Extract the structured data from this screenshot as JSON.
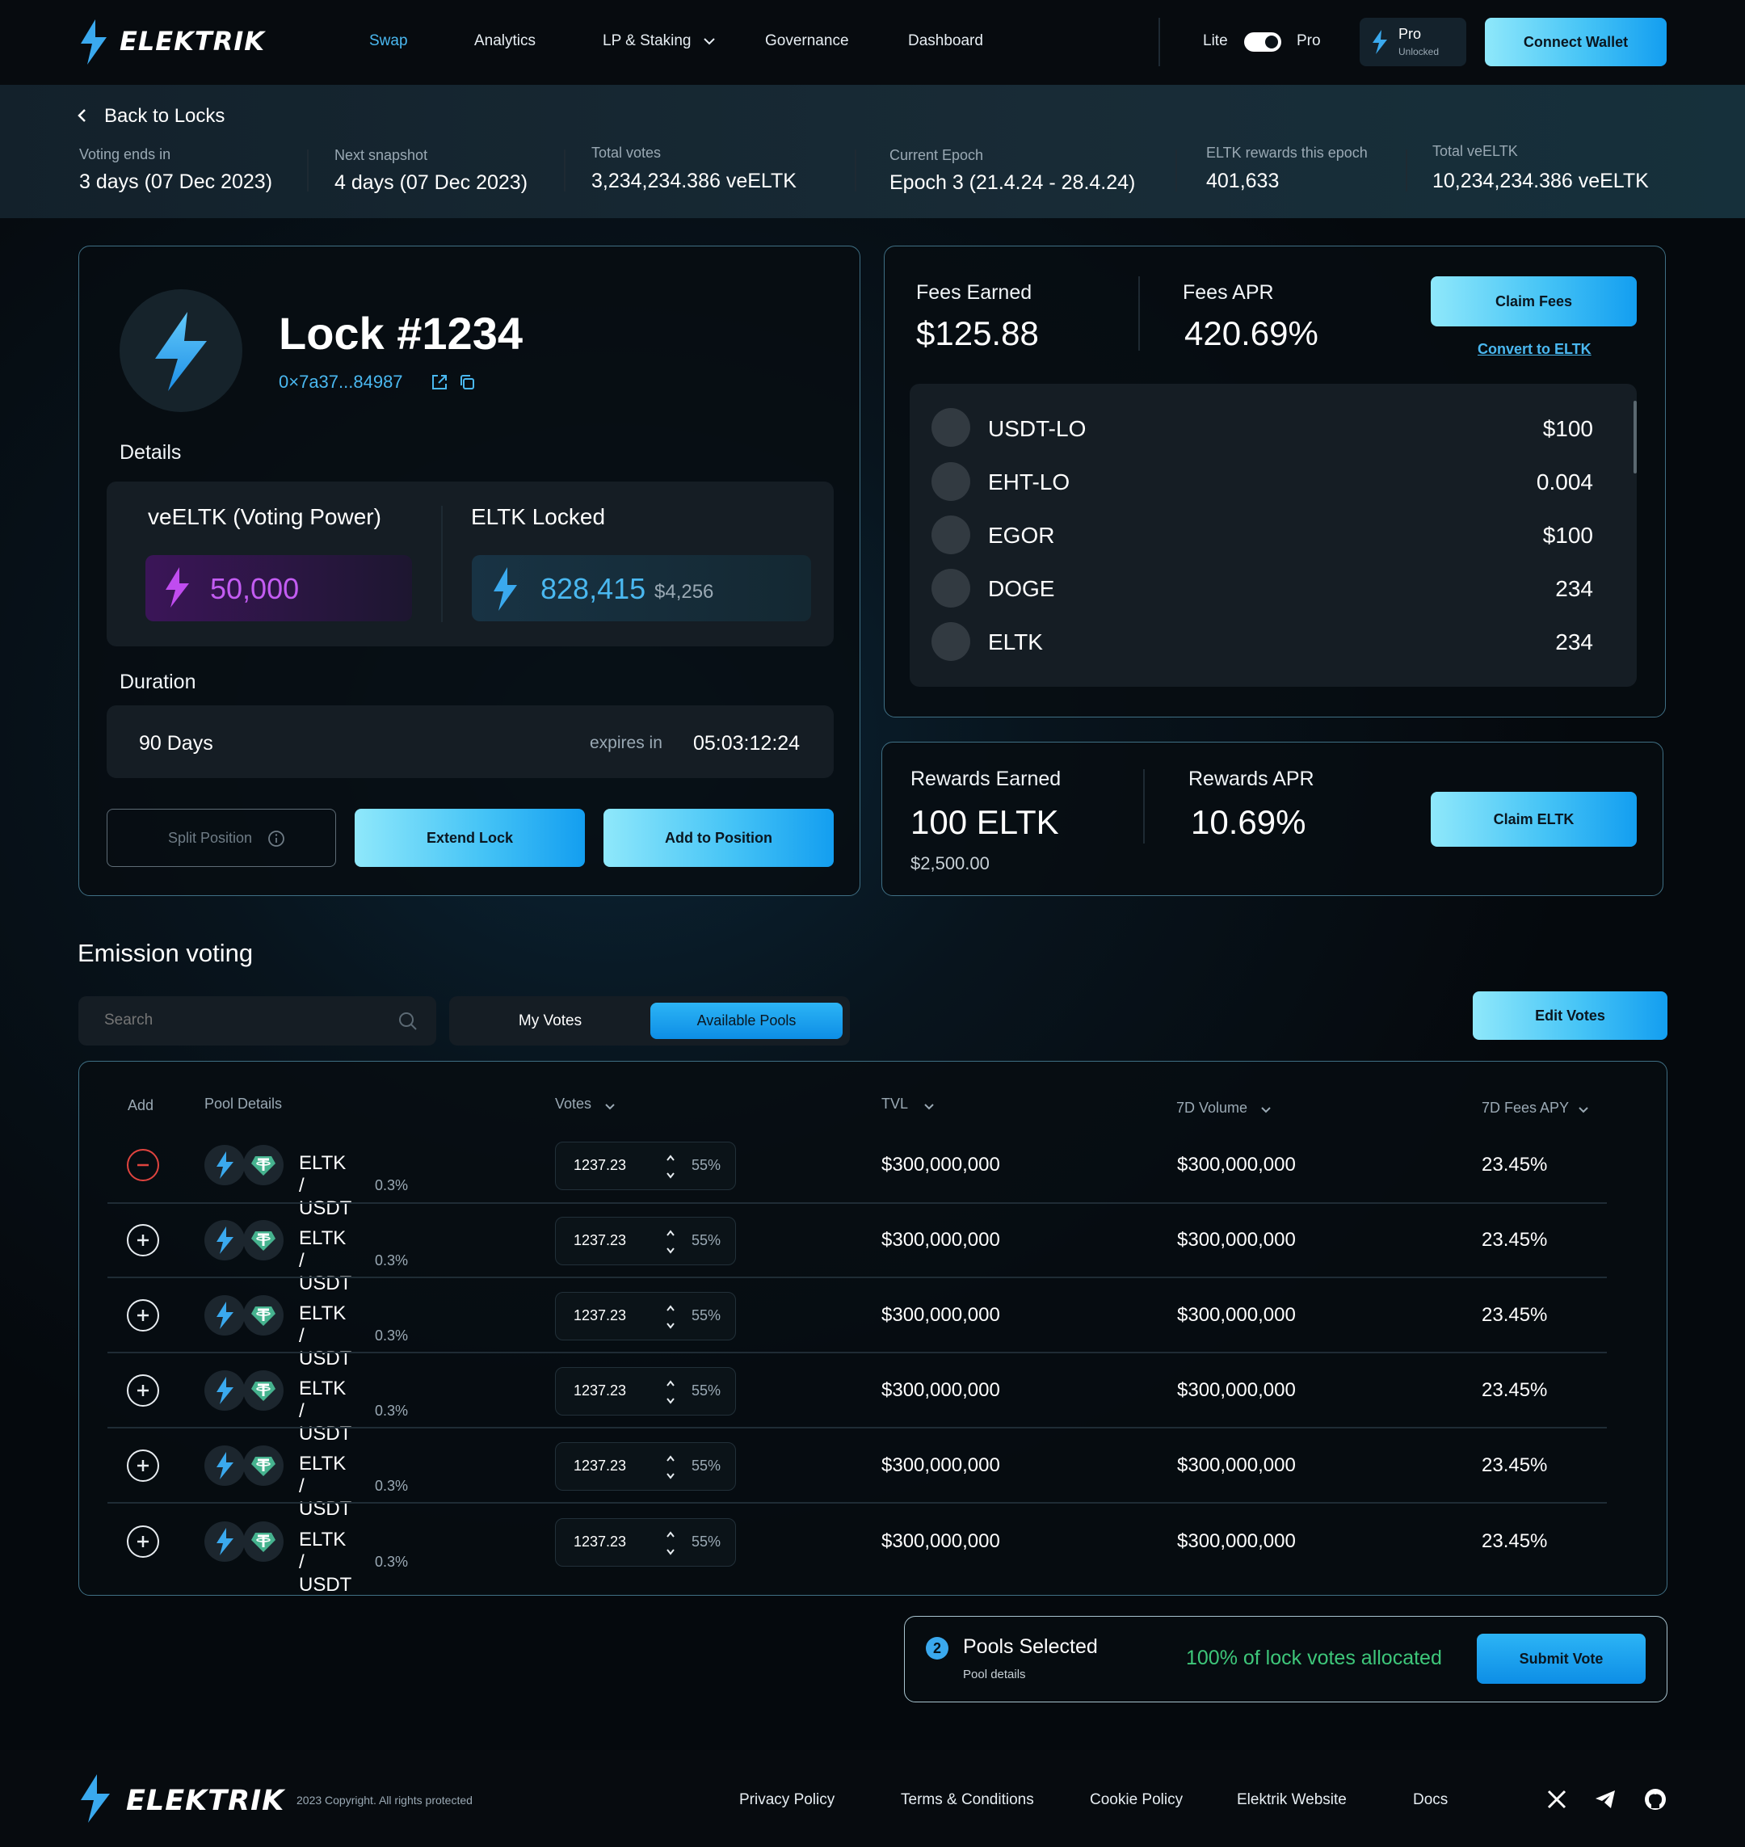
{
  "brand": {
    "name": "ELEKTRIK"
  },
  "nav": {
    "items": [
      "Swap",
      "Analytics",
      "LP & Staking",
      "Governance",
      "Dashboard"
    ],
    "mode_lite": "Lite",
    "mode_pro": "Pro",
    "pro_badge_title": "Pro",
    "pro_badge_sub": "Unlocked",
    "connect": "Connect Wallet"
  },
  "back": {
    "label": "Back to Locks"
  },
  "stats": [
    {
      "label": "Voting ends in",
      "value": "3 days (07 Dec 2023)"
    },
    {
      "label": "Next snapshot",
      "value": "4 days (07 Dec 2023)"
    },
    {
      "label": "Total votes",
      "value": "3,234,234.386 veELTK"
    },
    {
      "label": "Current Epoch",
      "value": "Epoch 3 (21.4.24 - 28.4.24)"
    },
    {
      "label": "ELTK rewards this epoch",
      "value": "401,633"
    },
    {
      "label": "Total veELTK",
      "value": "10,234,234.386 veELTK"
    }
  ],
  "lock": {
    "title": "Lock #1234",
    "address": "0×7a37...84987",
    "details_label": "Details",
    "voting_power_label": "veELTK (Voting Power)",
    "voting_power_value": "50,000",
    "locked_label": "ELTK Locked",
    "locked_value": "828,415",
    "locked_usd": "$4,256",
    "duration_label": "Duration",
    "duration_value": "90 Days",
    "expires_label": "expires in",
    "expires_value": "05:03:12:24",
    "btn_split": "Split Position",
    "btn_extend": "Extend Lock",
    "btn_add": "Add to Position"
  },
  "fees": {
    "earned_label": "Fees Earned",
    "earned_value": "$125.88",
    "apr_label": "Fees APR",
    "apr_value": "420.69%",
    "claim": "Claim Fees",
    "convert": "Convert to ELTK",
    "tokens": [
      {
        "name": "USDT-LO",
        "value": "$100"
      },
      {
        "name": "EHT-LO",
        "value": "0.004"
      },
      {
        "name": "EGOR",
        "value": "$100"
      },
      {
        "name": "DOGE",
        "value": "234"
      },
      {
        "name": "ELTK",
        "value": "234"
      }
    ]
  },
  "rewards": {
    "earned_label": "Rewards Earned",
    "earned_value": "100 ELTK",
    "earned_usd": "$2,500.00",
    "apr_label": "Rewards APR",
    "apr_value": "10.69%",
    "claim": "Claim ELTK"
  },
  "voting": {
    "title": "Emission voting",
    "search_placeholder": "Search",
    "tab_my": "My Votes",
    "tab_available": "Available Pools",
    "edit": "Edit Votes",
    "columns": [
      "Add",
      "Pool Details",
      "Votes",
      "TVL",
      "7D Volume",
      "7D Fees APY"
    ],
    "rows": [
      {
        "pair": "ELTK / USDT",
        "fee": "0.3%",
        "votes": "1237.23",
        "pct": "55%",
        "tvl": "$300,000,000",
        "volume": "$300,000,000",
        "apy": "23.45%"
      },
      {
        "pair": "ELTK / USDT",
        "fee": "0.3%",
        "votes": "1237.23",
        "pct": "55%",
        "tvl": "$300,000,000",
        "volume": "$300,000,000",
        "apy": "23.45%"
      },
      {
        "pair": "ELTK / USDT",
        "fee": "0.3%",
        "votes": "1237.23",
        "pct": "55%",
        "tvl": "$300,000,000",
        "volume": "$300,000,000",
        "apy": "23.45%"
      },
      {
        "pair": "ELTK / USDT",
        "fee": "0.3%",
        "votes": "1237.23",
        "pct": "55%",
        "tvl": "$300,000,000",
        "volume": "$300,000,000",
        "apy": "23.45%"
      },
      {
        "pair": "ELTK / USDT",
        "fee": "0.3%",
        "votes": "1237.23",
        "pct": "55%",
        "tvl": "$300,000,000",
        "volume": "$300,000,000",
        "apy": "23.45%"
      },
      {
        "pair": "ELTK / USDT",
        "fee": "0.3%",
        "votes": "1237.23",
        "pct": "55%",
        "tvl": "$300,000,000",
        "volume": "$300,000,000",
        "apy": "23.45%"
      }
    ]
  },
  "submit_bar": {
    "count": "2",
    "title": "Pools Selected",
    "sub": "Pool details",
    "allocated": "100% of lock votes allocated",
    "button": "Submit Vote"
  },
  "footer": {
    "copyright": "2023 Copyright. All rights protected",
    "links": [
      "Privacy Policy",
      "Terms & Conditions",
      "Cookie Policy",
      "Elektrik Website",
      "Docs"
    ]
  },
  "colors": {
    "accent": "#4ab8f0",
    "purple": "#c04cf0",
    "danger": "#e0443f",
    "success": "#3ec77a"
  }
}
